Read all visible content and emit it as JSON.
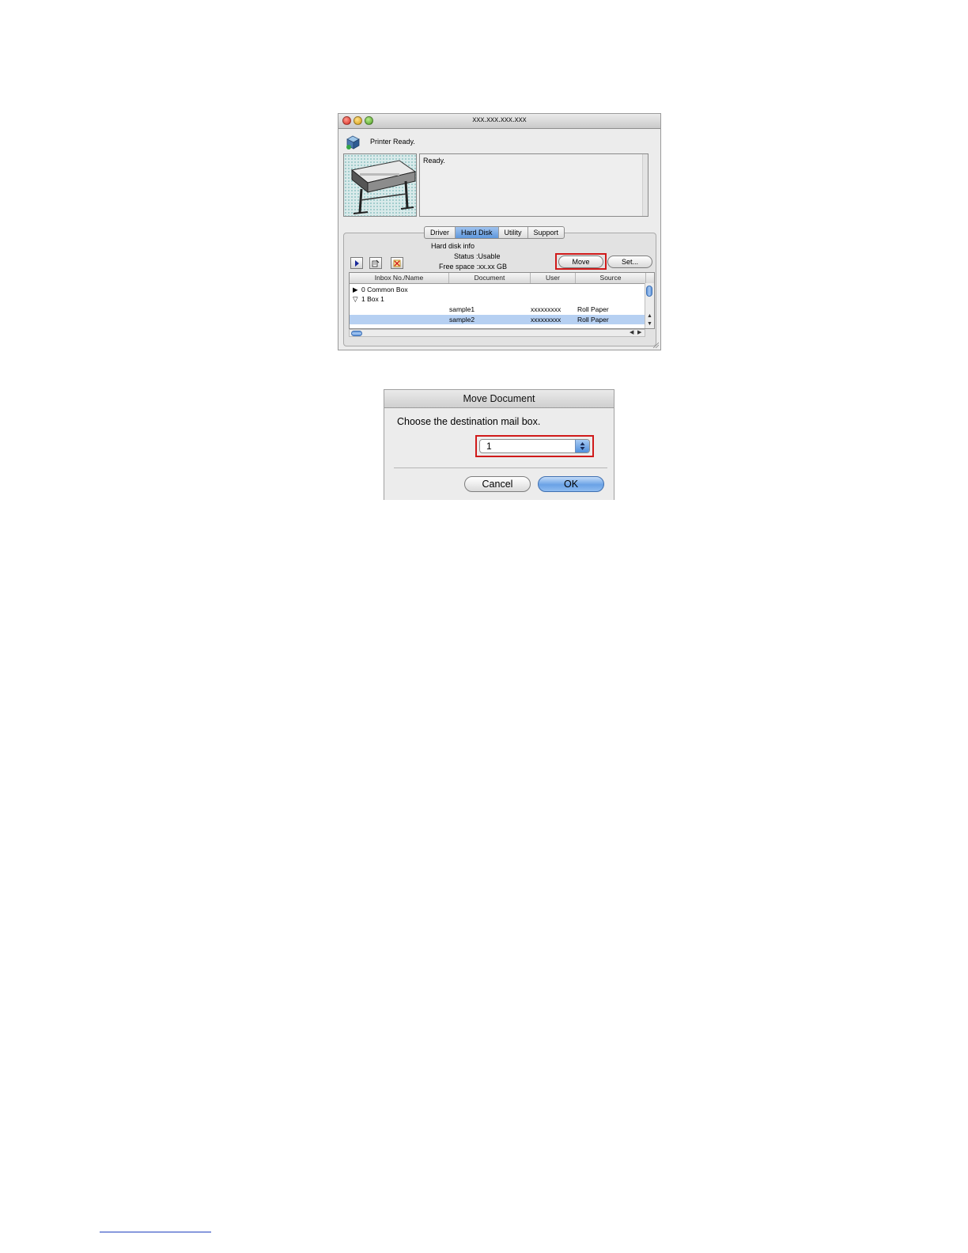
{
  "printer_window": {
    "title": "xxx.xxx.xxx.xxx",
    "status_text": "Printer Ready.",
    "message": "Ready.",
    "tabs": [
      {
        "label": "Driver",
        "active": false
      },
      {
        "label": "Hard Disk",
        "active": true
      },
      {
        "label": "Utility",
        "active": false
      },
      {
        "label": "Support",
        "active": false
      }
    ],
    "hard_disk": {
      "title": "Hard disk info",
      "status": "Status :Usable",
      "free_space": "Free space :xx.xx GB"
    },
    "buttons": {
      "move": "Move",
      "set": "Set..."
    },
    "columns": [
      "Inbox No./Name",
      "Document",
      "User",
      "Source"
    ],
    "rows": [
      {
        "expander": "▶",
        "name": "0 Common Box",
        "document": "",
        "user": "",
        "source": "",
        "selected": false
      },
      {
        "expander": "▽",
        "name": "1 Box 1",
        "document": "",
        "user": "",
        "source": "",
        "selected": false
      },
      {
        "expander": "",
        "name": "",
        "document": "sample1",
        "user": "xxxxxxxxx",
        "source": "Roll Paper",
        "selected": false
      },
      {
        "expander": "",
        "name": "",
        "document": "sample2",
        "user": "xxxxxxxxx",
        "source": "Roll Paper",
        "selected": true
      }
    ],
    "highlight_color": "#d01a1a"
  },
  "move_dialog": {
    "title": "Move Document",
    "prompt": "Choose the destination mail box.",
    "selected_box": "1",
    "cancel_label": "Cancel",
    "ok_label": "OK"
  }
}
